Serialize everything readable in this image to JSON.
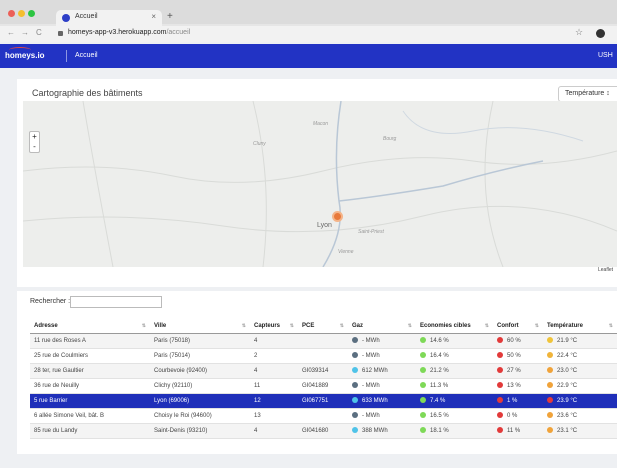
{
  "browser": {
    "tab_title": "Accueil",
    "tab_close": "×",
    "new_tab": "+",
    "back": "←",
    "forward": "→",
    "reload": "C",
    "url_host": "homeys-app-v3.herokuapp.com",
    "url_path": "/accueil",
    "bookmark": "☆"
  },
  "app": {
    "logo": "homeys.io",
    "nav_home": "Accueil",
    "user": "USH"
  },
  "map": {
    "title": "Cartographie des bâtiments",
    "metric_select": "Température ↕",
    "zoom_in": "+",
    "zoom_out": "-",
    "city_label": "Lyon",
    "attribution": "Leaflet",
    "place_labels": [
      "Macon",
      "Bourg",
      "Cluny",
      "Saint-Priest",
      "Vienne"
    ],
    "colors": {
      "marker": "#e8793b"
    }
  },
  "table": {
    "search_label": "Rechercher :",
    "search_value": "",
    "headers": [
      "Adresse",
      "Ville",
      "Capteurs",
      "PCE",
      "Gaz",
      "Economies cibles",
      "Confort",
      "Température"
    ],
    "rows": [
      {
        "adresse": "11 rue des Roses A",
        "ville": "Paris (75018)",
        "capteurs": "4",
        "pce": "",
        "gaz": "- MWh",
        "eco": "14.6 %",
        "confort": "60 %",
        "temp": "21.9 °C",
        "gaz_color": "#5b6f80",
        "eco_color": "#7ed957",
        "confort_color": "#e23a3a",
        "temp_color": "#f0c43a"
      },
      {
        "adresse": "25 rue de Coulmiers",
        "ville": "Paris (75014)",
        "capteurs": "2",
        "pce": "",
        "gaz": "- MWh",
        "eco": "16.4 %",
        "confort": "50 %",
        "temp": "22.4 °C",
        "gaz_color": "#5b6f80",
        "eco_color": "#7ed957",
        "confort_color": "#e23a3a",
        "temp_color": "#f0b43a"
      },
      {
        "adresse": "28 ter, rue Gaultier",
        "ville": "Courbevoie (92400)",
        "capteurs": "4",
        "pce": "GI039314",
        "gaz": "612 MWh",
        "eco": "21.2 %",
        "confort": "27 %",
        "temp": "23.0 °C",
        "gaz_color": "#4fc3e8",
        "eco_color": "#7ed957",
        "confort_color": "#e23a3a",
        "temp_color": "#f0a33a"
      },
      {
        "adresse": "36 rue de Neuilly",
        "ville": "Clichy (92110)",
        "capteurs": "11",
        "pce": "GI041889",
        "gaz": "- MWh",
        "eco": "11.3 %",
        "confort": "13 %",
        "temp": "22.9 °C",
        "gaz_color": "#5b6f80",
        "eco_color": "#7ed957",
        "confort_color": "#e23a3a",
        "temp_color": "#f0a33a"
      },
      {
        "adresse": "5 rue Barrier",
        "ville": "Lyon (69006)",
        "capteurs": "12",
        "pce": "GI067751",
        "gaz": "633 MWh",
        "eco": "7.4 %",
        "confort": "1 %",
        "temp": "23.9 °C",
        "gaz_color": "#4fc3e8",
        "eco_color": "#7ed957",
        "confort_color": "#e23a3a",
        "temp_color": "#e23a3a"
      },
      {
        "adresse": "6 allée Simone Veil, bât. B",
        "ville": "Choisy le Roi (94600)",
        "capteurs": "13",
        "pce": "",
        "gaz": "- MWh",
        "eco": "16.5 %",
        "confort": "0 %",
        "temp": "23.6 °C",
        "gaz_color": "#5b6f80",
        "eco_color": "#7ed957",
        "confort_color": "#e23a3a",
        "temp_color": "#f0a33a"
      },
      {
        "adresse": "85 rue du Landy",
        "ville": "Saint-Denis (93210)",
        "capteurs": "4",
        "pce": "GI041680",
        "gaz": "388 MWh",
        "eco": "18.1 %",
        "confort": "11 %",
        "temp": "23.1 °C",
        "gaz_color": "#4fc3e8",
        "eco_color": "#7ed957",
        "confort_color": "#e23a3a",
        "temp_color": "#f0a33a"
      }
    ],
    "selected_index": 4,
    "colors": {
      "selected_row": "#1f2fb9",
      "header_bar": "#2233c4"
    }
  }
}
